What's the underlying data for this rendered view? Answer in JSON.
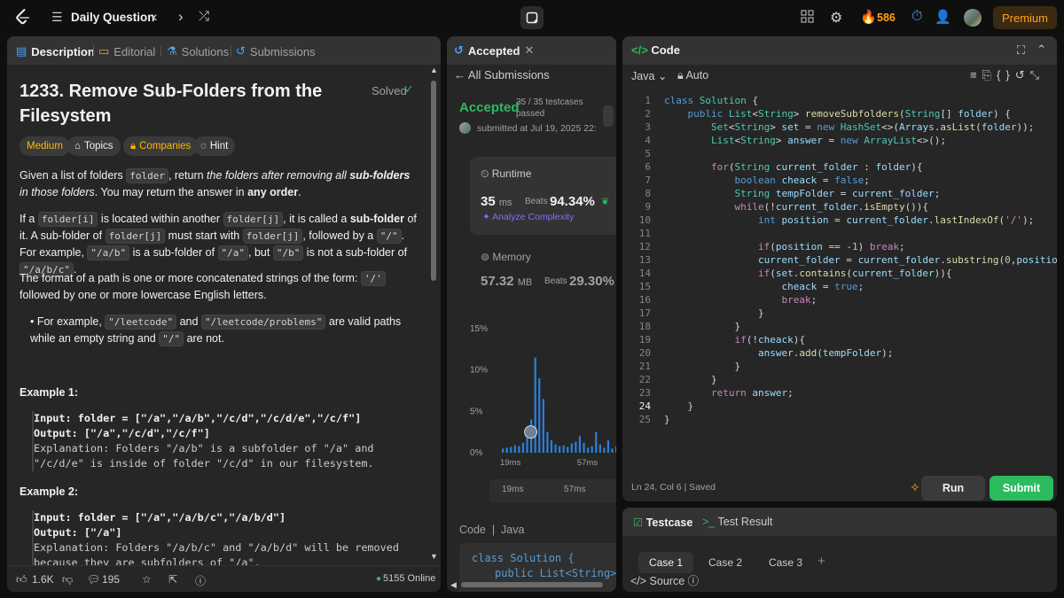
{
  "topbar": {
    "daily_label": "Daily Question",
    "streak": "586",
    "premium_label": "Premium"
  },
  "left": {
    "tabs": [
      "Description",
      "Editorial",
      "Solutions",
      "Submissions"
    ],
    "title": "1233. Remove Sub-Folders from the Filesystem",
    "solved": "Solved",
    "pills": {
      "difficulty": "Medium",
      "topics": "Topics",
      "companies": "Companies",
      "hint": "Hint"
    },
    "example1_title": "Example 1:",
    "example1_lines": [
      "Input: folder = [\"/a\",\"/a/b\",\"/c/d\",\"/c/d/e\",\"/c/f\"]",
      "Output: [\"/a\",\"/c/d\",\"/c/f\"]",
      "Explanation: Folders \"/a/b\" is a subfolder of \"/a\" and",
      "\"/c/d/e\" is inside of folder \"/c/d\" in our filesystem."
    ],
    "example2_title": "Example 2:",
    "example2_lines": [
      "Input: folder = [\"/a\",\"/a/b/c\",\"/a/b/d\"]",
      "Output: [\"/a\"]",
      "Explanation: Folders \"/a/b/c\" and \"/a/b/d\" will be removed",
      "because they are subfolders of \"/a\"."
    ],
    "footer": {
      "likes": "1.6K",
      "comments": "195",
      "online": "5155 Online"
    }
  },
  "middle": {
    "tab_label": "Accepted",
    "all_submissions": "All Submissions",
    "status": "Accepted",
    "testcases": "35 / 35 testcases",
    "testcases_sub": "passed",
    "submitted_at": "submitted at Jul 19, 2025 22:",
    "runtime_label": "Runtime",
    "runtime_value": "35",
    "runtime_unit": "ms",
    "beats_label": "Beats",
    "runtime_beats": "94.34%",
    "analyze": "Analyze Complexity",
    "memory_label": "Memory",
    "memory_value": "57.32",
    "memory_unit": "MB",
    "memory_beats": "29.30%",
    "code_label": "Code",
    "code_lang": "Java",
    "preview_line1": "class Solution {",
    "preview_line2": "public List<String> r"
  },
  "chart_data": {
    "type": "bar",
    "title": "",
    "xlabel": "",
    "ylabel": "",
    "y_ticks": [
      "15%",
      "10%",
      "5%",
      "0%"
    ],
    "x_ticks": [
      "19ms",
      "57ms"
    ],
    "ylim": [
      0,
      15
    ],
    "x": [
      19,
      21,
      23,
      25,
      27,
      29,
      31,
      33,
      35,
      37,
      39,
      41,
      43,
      45,
      47,
      49,
      51,
      53,
      55,
      57,
      59,
      61,
      63,
      65,
      67,
      69,
      71,
      73,
      75
    ],
    "values": [
      0.5,
      0.6,
      0.7,
      0.9,
      0.8,
      1.2,
      1.8,
      4.0,
      11.5,
      9.0,
      6.5,
      2.5,
      1.5,
      1.0,
      0.8,
      0.9,
      0.7,
      1.1,
      1.3,
      2.0,
      1.2,
      0.6,
      0.8,
      2.5,
      1.0,
      0.6,
      1.5,
      0.5,
      0.8
    ],
    "mini_ticks": [
      "19ms",
      "57ms"
    ]
  },
  "code": {
    "tab_label": "Code",
    "language": "Java",
    "mode": "Auto",
    "status": "Ln 24, Col 6  |  Saved",
    "run_label": "Run",
    "submit_label": "Submit"
  },
  "tests": {
    "testcase_label": "Testcase",
    "result_label": "Test Result",
    "cases": [
      "Case 1",
      "Case 2",
      "Case 3"
    ],
    "source_label": "Source"
  }
}
